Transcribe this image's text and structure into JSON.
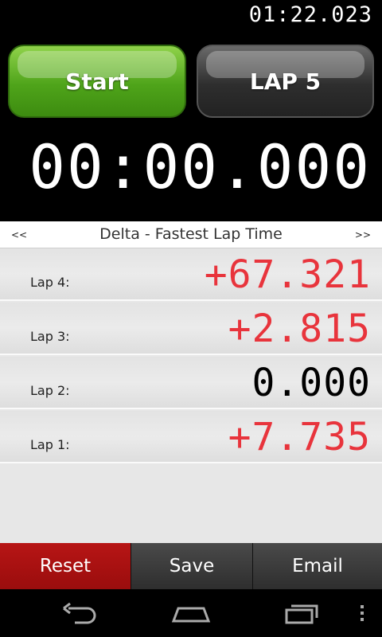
{
  "header": {
    "total_time": "01:22.023"
  },
  "controls": {
    "start_label": "Start",
    "lap_label": "LAP 5"
  },
  "stopwatch": {
    "time": "00:00.000"
  },
  "lap_nav": {
    "prev": "<<",
    "title": "Delta - Fastest Lap Time",
    "next": ">>"
  },
  "laps": [
    {
      "label": "Lap 4:",
      "delta": "+67.321",
      "color": "#e8343c"
    },
    {
      "label": "Lap 3:",
      "delta": "+2.815",
      "color": "#e8343c"
    },
    {
      "label": "Lap 2:",
      "delta": "0.000",
      "color": "#000000"
    },
    {
      "label": "Lap 1:",
      "delta": "+7.735",
      "color": "#e8343c"
    }
  ],
  "actions": {
    "reset_label": "Reset",
    "save_label": "Save",
    "email_label": "Email"
  },
  "system_nav": {
    "icons": [
      "back-icon",
      "home-icon",
      "recent-apps-icon",
      "overflow-menu-icon"
    ]
  },
  "colors": {
    "start_green": "#4fa41a",
    "reset_red": "#b71515",
    "delta_red": "#e8343c"
  }
}
